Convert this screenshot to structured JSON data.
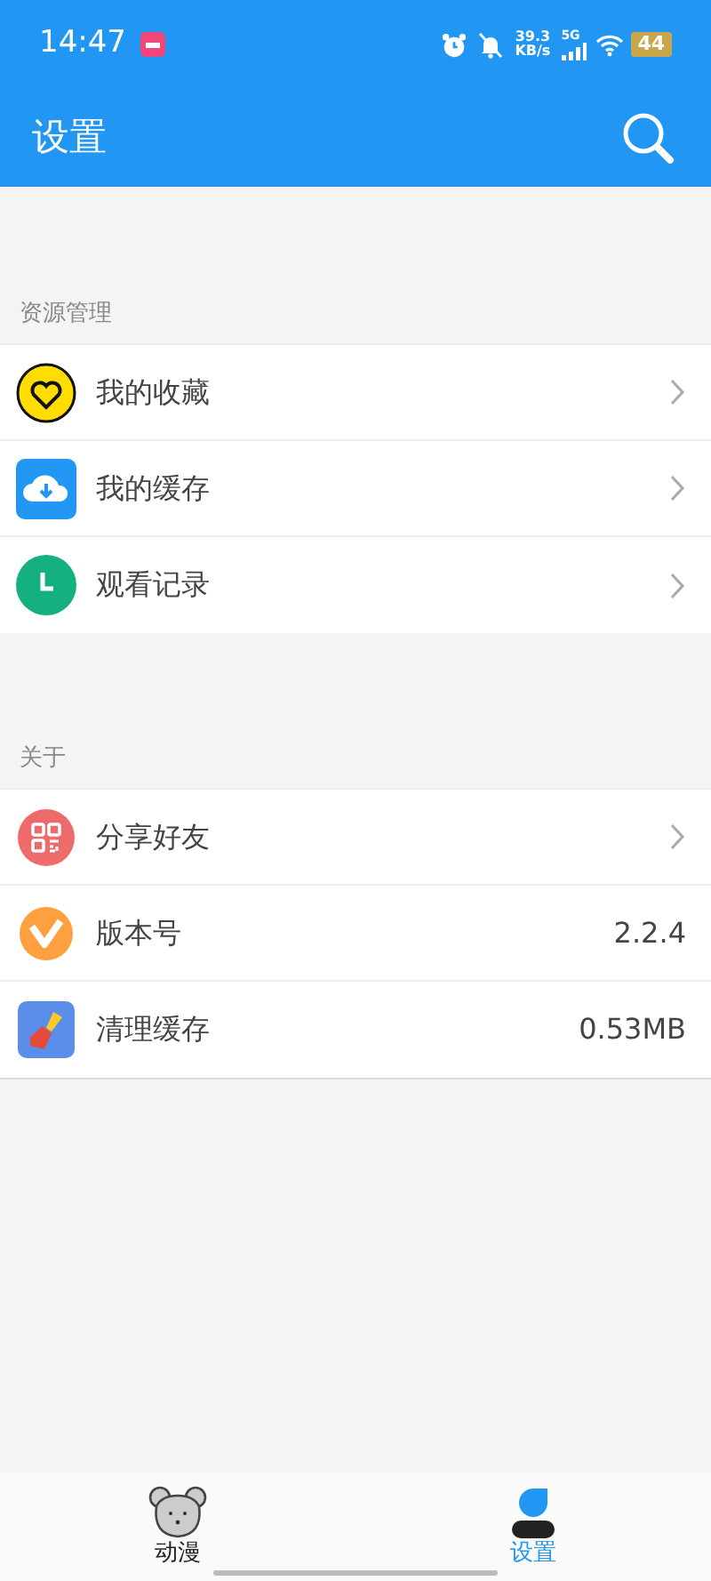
{
  "status_bar": {
    "time": "14:47",
    "speed": "39.3",
    "speed_unit": "KB/s",
    "network": "5G",
    "battery": "44"
  },
  "header": {
    "title": "设置"
  },
  "sections": [
    {
      "title": "资源管理",
      "items": [
        {
          "label": "我的收藏",
          "kind": "link"
        },
        {
          "label": "我的缓存",
          "kind": "link"
        },
        {
          "label": "观看记录",
          "kind": "link"
        }
      ]
    },
    {
      "title": "关于",
      "items": [
        {
          "label": "分享好友",
          "kind": "link"
        },
        {
          "label": "版本号",
          "kind": "value",
          "value": "2.2.4"
        },
        {
          "label": "清理缓存",
          "kind": "value",
          "value": "0.53MB"
        }
      ]
    }
  ],
  "tabs": [
    {
      "label": "动漫",
      "selected": false
    },
    {
      "label": "设置",
      "selected": true
    }
  ]
}
